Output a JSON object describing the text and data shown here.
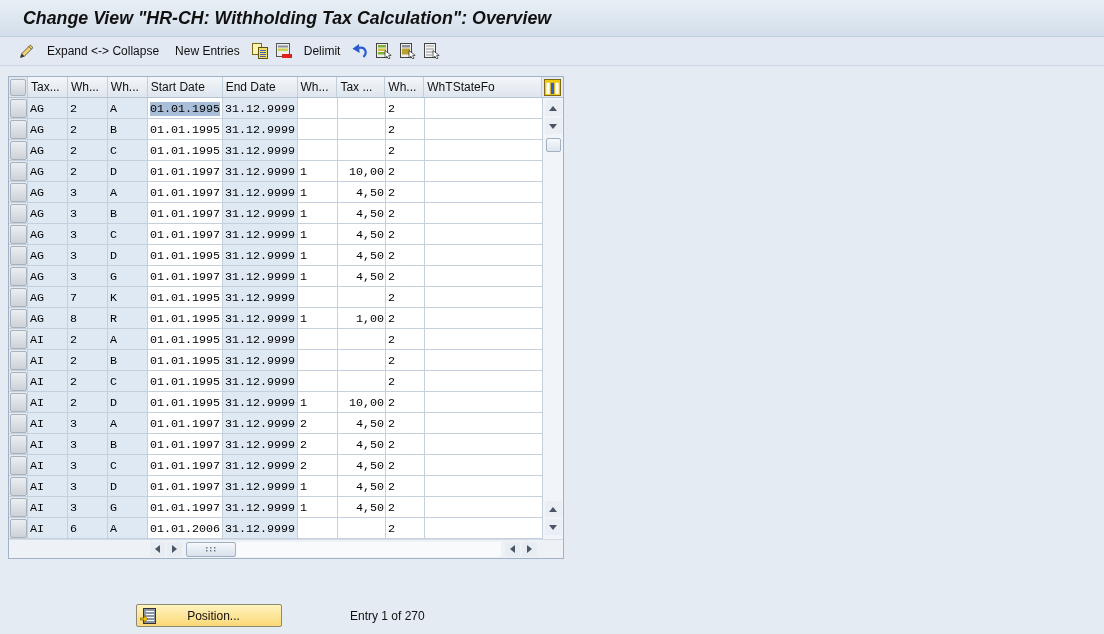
{
  "window": {
    "title": "Change View \"HR-CH: Withholding Tax Calculation\": Overview"
  },
  "toolbar": [
    {
      "kind": "pencil"
    },
    {
      "kind": "text",
      "label": "Expand <-> Collapse"
    },
    {
      "kind": "text",
      "label": "New Entries"
    },
    {
      "kind": "copy"
    },
    {
      "kind": "delete"
    },
    {
      "kind": "text",
      "label": "Delimit"
    },
    {
      "kind": "undo"
    },
    {
      "kind": "selectall"
    },
    {
      "kind": "selectblock"
    },
    {
      "kind": "deselectall"
    }
  ],
  "table": {
    "columns": [
      {
        "label": "Tax...",
        "editable": false,
        "kind": "text"
      },
      {
        "label": "Wh...",
        "editable": false,
        "kind": "text"
      },
      {
        "label": "Wh...",
        "editable": false,
        "kind": "text"
      },
      {
        "label": "Start Date",
        "editable": true,
        "kind": "text"
      },
      {
        "label": "End Date",
        "editable": false,
        "kind": "text"
      },
      {
        "label": "Wh...",
        "editable": true,
        "kind": "text"
      },
      {
        "label": "Tax ...",
        "editable": true,
        "kind": "amount"
      },
      {
        "label": "Wh...",
        "editable": true,
        "kind": "text"
      },
      {
        "label": "WhTStateFo",
        "editable": true,
        "kind": "text"
      }
    ],
    "rows": [
      {
        "selected": false,
        "cells": [
          {
            "text": "AG",
            "selected": false
          },
          {
            "text": "2",
            "selected": false
          },
          {
            "text": "A",
            "selected": false
          },
          {
            "text": "01.01.1995",
            "selected": true
          },
          {
            "text": "31.12.9999",
            "selected": false
          },
          {
            "selected": false
          },
          {
            "selected": false
          },
          {
            "text": "2",
            "selected": false
          },
          {
            "selected": false
          }
        ]
      },
      {
        "selected": false,
        "cells": [
          {
            "text": "AG",
            "selected": false
          },
          {
            "text": "2",
            "selected": false
          },
          {
            "text": "B",
            "selected": false
          },
          {
            "text": "01.01.1995",
            "selected": false
          },
          {
            "text": "31.12.9999",
            "selected": false
          },
          {
            "selected": false
          },
          {
            "selected": false
          },
          {
            "text": "2",
            "selected": false
          },
          {
            "selected": false
          }
        ]
      },
      {
        "selected": false,
        "cells": [
          {
            "text": "AG",
            "selected": false
          },
          {
            "text": "2",
            "selected": false
          },
          {
            "text": "C",
            "selected": false
          },
          {
            "text": "01.01.1995",
            "selected": false
          },
          {
            "text": "31.12.9999",
            "selected": false
          },
          {
            "selected": false
          },
          {
            "selected": false
          },
          {
            "text": "2",
            "selected": false
          },
          {
            "selected": false
          }
        ]
      },
      {
        "selected": false,
        "cells": [
          {
            "text": "AG",
            "selected": false
          },
          {
            "text": "2",
            "selected": false
          },
          {
            "text": "D",
            "selected": false
          },
          {
            "text": "01.01.1997",
            "selected": false
          },
          {
            "text": "31.12.9999",
            "selected": false
          },
          {
            "text": "1",
            "selected": false
          },
          {
            "text": "10,00",
            "selected": false
          },
          {
            "text": "2",
            "selected": false
          },
          {
            "selected": false
          }
        ]
      },
      {
        "selected": false,
        "cells": [
          {
            "text": "AG",
            "selected": false
          },
          {
            "text": "3",
            "selected": false
          },
          {
            "text": "A",
            "selected": false
          },
          {
            "text": "01.01.1997",
            "selected": false
          },
          {
            "text": "31.12.9999",
            "selected": false
          },
          {
            "text": "1",
            "selected": false
          },
          {
            "text": "4,50",
            "selected": false
          },
          {
            "text": "2",
            "selected": false
          },
          {
            "selected": false
          }
        ]
      },
      {
        "selected": false,
        "cells": [
          {
            "text": "AG",
            "selected": false
          },
          {
            "text": "3",
            "selected": false
          },
          {
            "text": "B",
            "selected": false
          },
          {
            "text": "01.01.1997",
            "selected": false
          },
          {
            "text": "31.12.9999",
            "selected": false
          },
          {
            "text": "1",
            "selected": false
          },
          {
            "text": "4,50",
            "selected": false
          },
          {
            "text": "2",
            "selected": false
          },
          {
            "selected": false
          }
        ]
      },
      {
        "selected": false,
        "cells": [
          {
            "text": "AG",
            "selected": false
          },
          {
            "text": "3",
            "selected": false
          },
          {
            "text": "C",
            "selected": false
          },
          {
            "text": "01.01.1997",
            "selected": false
          },
          {
            "text": "31.12.9999",
            "selected": false
          },
          {
            "text": "1",
            "selected": false
          },
          {
            "text": "4,50",
            "selected": false
          },
          {
            "text": "2",
            "selected": false
          },
          {
            "selected": false
          }
        ]
      },
      {
        "selected": false,
        "cells": [
          {
            "text": "AG",
            "selected": false
          },
          {
            "text": "3",
            "selected": false
          },
          {
            "text": "D",
            "selected": false
          },
          {
            "text": "01.01.1995",
            "selected": false
          },
          {
            "text": "31.12.9999",
            "selected": false
          },
          {
            "text": "1",
            "selected": false
          },
          {
            "text": "4,50",
            "selected": false
          },
          {
            "text": "2",
            "selected": false
          },
          {
            "selected": false
          }
        ]
      },
      {
        "selected": false,
        "cells": [
          {
            "text": "AG",
            "selected": false
          },
          {
            "text": "3",
            "selected": false
          },
          {
            "text": "G",
            "selected": false
          },
          {
            "text": "01.01.1997",
            "selected": false
          },
          {
            "text": "31.12.9999",
            "selected": false
          },
          {
            "text": "1",
            "selected": false
          },
          {
            "text": "4,50",
            "selected": false
          },
          {
            "text": "2",
            "selected": false
          },
          {
            "selected": false
          }
        ]
      },
      {
        "selected": false,
        "cells": [
          {
            "text": "AG",
            "selected": false
          },
          {
            "text": "7",
            "selected": false
          },
          {
            "text": "K",
            "selected": false
          },
          {
            "text": "01.01.1995",
            "selected": false
          },
          {
            "text": "31.12.9999",
            "selected": false
          },
          {
            "selected": false
          },
          {
            "selected": false
          },
          {
            "text": "2",
            "selected": false
          },
          {
            "selected": false
          }
        ]
      },
      {
        "selected": false,
        "cells": [
          {
            "text": "AG",
            "selected": false
          },
          {
            "text": "8",
            "selected": false
          },
          {
            "text": "R",
            "selected": false
          },
          {
            "text": "01.01.1995",
            "selected": false
          },
          {
            "text": "31.12.9999",
            "selected": false
          },
          {
            "text": "1",
            "selected": false
          },
          {
            "text": "1,00",
            "selected": false
          },
          {
            "text": "2",
            "selected": false
          },
          {
            "selected": false
          }
        ]
      },
      {
        "selected": false,
        "cells": [
          {
            "text": "AI",
            "selected": false
          },
          {
            "text": "2",
            "selected": false
          },
          {
            "text": "A",
            "selected": false
          },
          {
            "text": "01.01.1995",
            "selected": false
          },
          {
            "text": "31.12.9999",
            "selected": false
          },
          {
            "selected": false
          },
          {
            "selected": false
          },
          {
            "text": "2",
            "selected": false
          },
          {
            "selected": false
          }
        ]
      },
      {
        "selected": false,
        "cells": [
          {
            "text": "AI",
            "selected": false
          },
          {
            "text": "2",
            "selected": false
          },
          {
            "text": "B",
            "selected": false
          },
          {
            "text": "01.01.1995",
            "selected": false
          },
          {
            "text": "31.12.9999",
            "selected": false
          },
          {
            "selected": false
          },
          {
            "selected": false
          },
          {
            "text": "2",
            "selected": false
          },
          {
            "selected": false
          }
        ]
      },
      {
        "selected": false,
        "cells": [
          {
            "text": "AI",
            "selected": false
          },
          {
            "text": "2",
            "selected": false
          },
          {
            "text": "C",
            "selected": false
          },
          {
            "text": "01.01.1995",
            "selected": false
          },
          {
            "text": "31.12.9999",
            "selected": false
          },
          {
            "selected": false
          },
          {
            "selected": false
          },
          {
            "text": "2",
            "selected": false
          },
          {
            "selected": false
          }
        ]
      },
      {
        "selected": false,
        "cells": [
          {
            "text": "AI",
            "selected": false
          },
          {
            "text": "2",
            "selected": false
          },
          {
            "text": "D",
            "selected": false
          },
          {
            "text": "01.01.1995",
            "selected": false
          },
          {
            "text": "31.12.9999",
            "selected": false
          },
          {
            "text": "1",
            "selected": false
          },
          {
            "text": "10,00",
            "selected": false
          },
          {
            "text": "2",
            "selected": false
          },
          {
            "selected": false
          }
        ]
      },
      {
        "selected": false,
        "cells": [
          {
            "text": "AI",
            "selected": false
          },
          {
            "text": "3",
            "selected": false
          },
          {
            "text": "A",
            "selected": false
          },
          {
            "text": "01.01.1997",
            "selected": false
          },
          {
            "text": "31.12.9999",
            "selected": false
          },
          {
            "text": "2",
            "selected": false
          },
          {
            "text": "4,50",
            "selected": false
          },
          {
            "text": "2",
            "selected": false
          },
          {
            "selected": false
          }
        ]
      },
      {
        "selected": false,
        "cells": [
          {
            "text": "AI",
            "selected": false
          },
          {
            "text": "3",
            "selected": false
          },
          {
            "text": "B",
            "selected": false
          },
          {
            "text": "01.01.1997",
            "selected": false
          },
          {
            "text": "31.12.9999",
            "selected": false
          },
          {
            "text": "2",
            "selected": false
          },
          {
            "text": "4,50",
            "selected": false
          },
          {
            "text": "2",
            "selected": false
          },
          {
            "selected": false
          }
        ]
      },
      {
        "selected": false,
        "cells": [
          {
            "text": "AI",
            "selected": false
          },
          {
            "text": "3",
            "selected": false
          },
          {
            "text": "C",
            "selected": false
          },
          {
            "text": "01.01.1997",
            "selected": false
          },
          {
            "text": "31.12.9999",
            "selected": false
          },
          {
            "text": "2",
            "selected": false
          },
          {
            "text": "4,50",
            "selected": false
          },
          {
            "text": "2",
            "selected": false
          },
          {
            "selected": false
          }
        ]
      },
      {
        "selected": false,
        "cells": [
          {
            "text": "AI",
            "selected": false
          },
          {
            "text": "3",
            "selected": false
          },
          {
            "text": "D",
            "selected": false
          },
          {
            "text": "01.01.1997",
            "selected": false
          },
          {
            "text": "31.12.9999",
            "selected": false
          },
          {
            "text": "1",
            "selected": false
          },
          {
            "text": "4,50",
            "selected": false
          },
          {
            "text": "2",
            "selected": false
          },
          {
            "selected": false
          }
        ]
      },
      {
        "selected": false,
        "cells": [
          {
            "text": "AI",
            "selected": false
          },
          {
            "text": "3",
            "selected": false
          },
          {
            "text": "G",
            "selected": false
          },
          {
            "text": "01.01.1997",
            "selected": false
          },
          {
            "text": "31.12.9999",
            "selected": false
          },
          {
            "text": "1",
            "selected": false
          },
          {
            "text": "4,50",
            "selected": false
          },
          {
            "text": "2",
            "selected": false
          },
          {
            "selected": false
          }
        ]
      },
      {
        "selected": false,
        "cells": [
          {
            "text": "AI",
            "selected": false
          },
          {
            "text": "6",
            "selected": false
          },
          {
            "text": "A",
            "selected": false
          },
          {
            "text": "01.01.2006",
            "selected": false
          },
          {
            "text": "31.12.9999",
            "selected": false
          },
          {
            "selected": false
          },
          {
            "selected": false
          },
          {
            "text": "2",
            "selected": false
          },
          {
            "selected": false
          }
        ]
      }
    ]
  },
  "footer": {
    "position_button": "Position...",
    "entry_info": "Entry 1 of 270"
  }
}
